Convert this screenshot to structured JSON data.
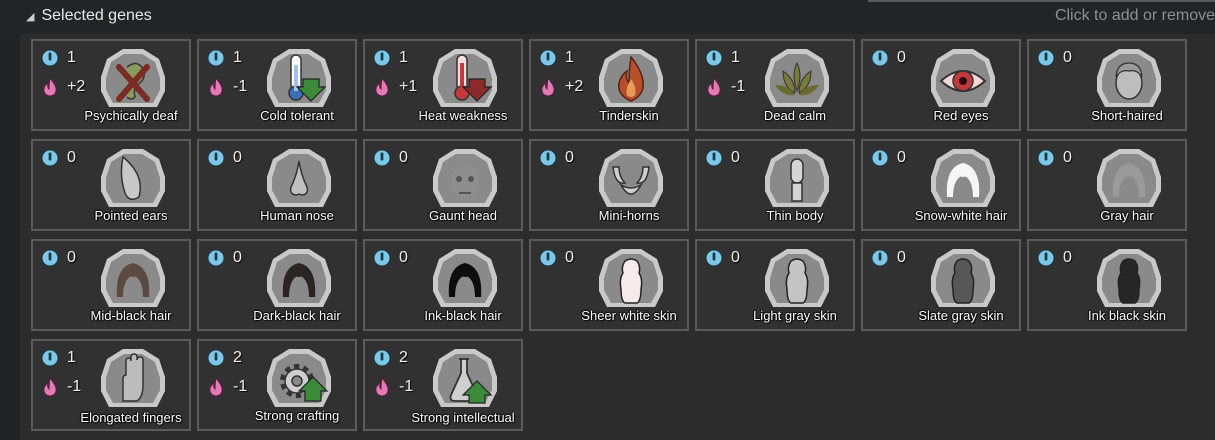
{
  "header": {
    "title": "Selected genes",
    "hint": "Click to add or remove"
  },
  "colors": {
    "complexity": "#7ec7e6",
    "metabolism": "#e37ab6",
    "frame_bg": "#c9c9c9",
    "frame_inner": "#8a8a8a"
  },
  "genes": [
    {
      "name": "Psychically deaf",
      "complexity": "1",
      "metabolism": "+2",
      "icon": "crossed-ear-icon"
    },
    {
      "name": "Cold tolerant",
      "complexity": "1",
      "metabolism": "-1",
      "icon": "thermometer-cold-icon"
    },
    {
      "name": "Heat weakness",
      "complexity": "1",
      "metabolism": "+1",
      "icon": "thermometer-hot-icon"
    },
    {
      "name": "Tinderskin",
      "complexity": "1",
      "metabolism": "+2",
      "icon": "flame-icon"
    },
    {
      "name": "Dead calm",
      "complexity": "1",
      "metabolism": "-1",
      "icon": "lotus-icon"
    },
    {
      "name": "Red eyes",
      "complexity": "0",
      "metabolism": "",
      "icon": "red-eye-icon"
    },
    {
      "name": "Short-haired",
      "complexity": "0",
      "metabolism": "",
      "icon": "short-hair-head-icon"
    },
    {
      "name": "Pointed ears",
      "complexity": "0",
      "metabolism": "",
      "icon": "pointed-ear-icon"
    },
    {
      "name": "Human nose",
      "complexity": "0",
      "metabolism": "",
      "icon": "nose-icon"
    },
    {
      "name": "Gaunt head",
      "complexity": "0",
      "metabolism": "",
      "icon": "gaunt-head-icon"
    },
    {
      "name": "Mini-horns",
      "complexity": "0",
      "metabolism": "",
      "icon": "horns-icon"
    },
    {
      "name": "Thin body",
      "complexity": "0",
      "metabolism": "",
      "icon": "thin-body-icon"
    },
    {
      "name": "Snow-white hair",
      "complexity": "0",
      "metabolism": "",
      "icon": "white-hair-icon"
    },
    {
      "name": "Gray hair",
      "complexity": "0",
      "metabolism": "",
      "icon": "gray-hair-icon"
    },
    {
      "name": "Mid-black hair",
      "complexity": "0",
      "metabolism": "",
      "icon": "mid-black-hair-icon"
    },
    {
      "name": "Dark-black hair",
      "complexity": "0",
      "metabolism": "",
      "icon": "dark-black-hair-icon"
    },
    {
      "name": "Ink-black hair",
      "complexity": "0",
      "metabolism": "",
      "icon": "ink-black-hair-icon"
    },
    {
      "name": "Sheer white skin",
      "complexity": "0",
      "metabolism": "",
      "icon": "sheer-white-skin-icon"
    },
    {
      "name": "Light gray skin",
      "complexity": "0",
      "metabolism": "",
      "icon": "light-gray-skin-icon"
    },
    {
      "name": "Slate gray skin",
      "complexity": "0",
      "metabolism": "",
      "icon": "slate-gray-skin-icon"
    },
    {
      "name": "Ink black skin",
      "complexity": "0",
      "metabolism": "",
      "icon": "ink-black-skin-icon"
    },
    {
      "name": "Elongated fingers",
      "complexity": "1",
      "metabolism": "-1",
      "icon": "hand-icon"
    },
    {
      "name": "Strong crafting",
      "complexity": "2",
      "metabolism": "-1",
      "icon": "gear-up-arrow-icon"
    },
    {
      "name": "Strong intellectual",
      "complexity": "2",
      "metabolism": "-1",
      "icon": "flask-up-arrow-icon"
    }
  ]
}
